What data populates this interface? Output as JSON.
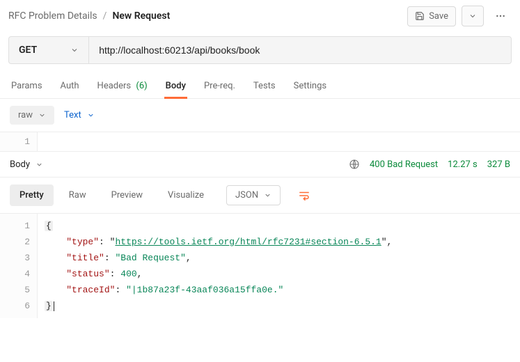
{
  "breadcrumb": {
    "parent": "RFC Problem Details",
    "current": "New Request"
  },
  "actions": {
    "save_label": "Save"
  },
  "request": {
    "method": "GET",
    "url": "http://localhost:60213/api/books/book"
  },
  "tabs": {
    "params": "Params",
    "auth": "Auth",
    "headers": "Headers",
    "headers_count": "(6)",
    "body": "Body",
    "prereq": "Pre-req.",
    "tests": "Tests",
    "settings": "Settings"
  },
  "body_sub": {
    "raw": "raw",
    "text": "Text"
  },
  "request_body_lines": [
    "1"
  ],
  "response_meta": {
    "section": "Body",
    "status": "400 Bad Request",
    "time": "12.27 s",
    "size": "327 B"
  },
  "response_tabs": {
    "pretty": "Pretty",
    "raw": "Raw",
    "preview": "Preview",
    "visualize": "Visualize",
    "format": "JSON"
  },
  "response_json": {
    "type": "https://tools.ietf.org/html/rfc7231#section-6.5.1",
    "title": "Bad Request",
    "status": 400,
    "traceId": "|1b87a23f-43aaf036a15ffa0e."
  },
  "chart_data": null
}
